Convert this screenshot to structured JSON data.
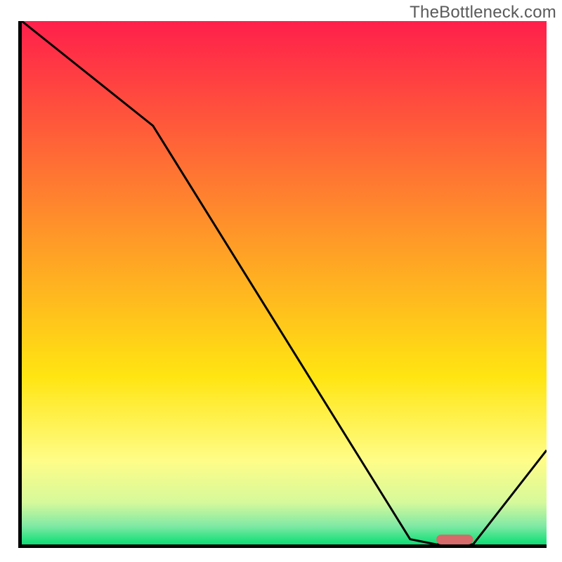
{
  "watermark": "TheBottleneck.com",
  "chart_data": {
    "type": "line",
    "title": "",
    "xlabel": "",
    "ylabel": "",
    "xlim": [
      0,
      100
    ],
    "ylim": [
      0,
      100
    ],
    "grid": false,
    "legend": false,
    "series": [
      {
        "name": "curve",
        "x": [
          0,
          25,
          74,
          79,
          86,
          100
        ],
        "values": [
          100,
          80,
          1,
          0,
          0,
          18
        ]
      }
    ],
    "marker": {
      "name": "optimal-zone",
      "x_start": 79,
      "x_end": 86,
      "y": 0,
      "color": "#d66a6a"
    },
    "background_gradient": {
      "stops": [
        {
          "pos": 0.0,
          "color": "#ff1f4b"
        },
        {
          "pos": 0.45,
          "color": "#ffa325"
        },
        {
          "pos": 0.68,
          "color": "#ffe512"
        },
        {
          "pos": 0.84,
          "color": "#fffd88"
        },
        {
          "pos": 0.92,
          "color": "#d6f99b"
        },
        {
          "pos": 0.965,
          "color": "#7fe9a4"
        },
        {
          "pos": 1.0,
          "color": "#0ade73"
        }
      ]
    },
    "axis_color": "#000000",
    "curve_color": "#000000"
  }
}
